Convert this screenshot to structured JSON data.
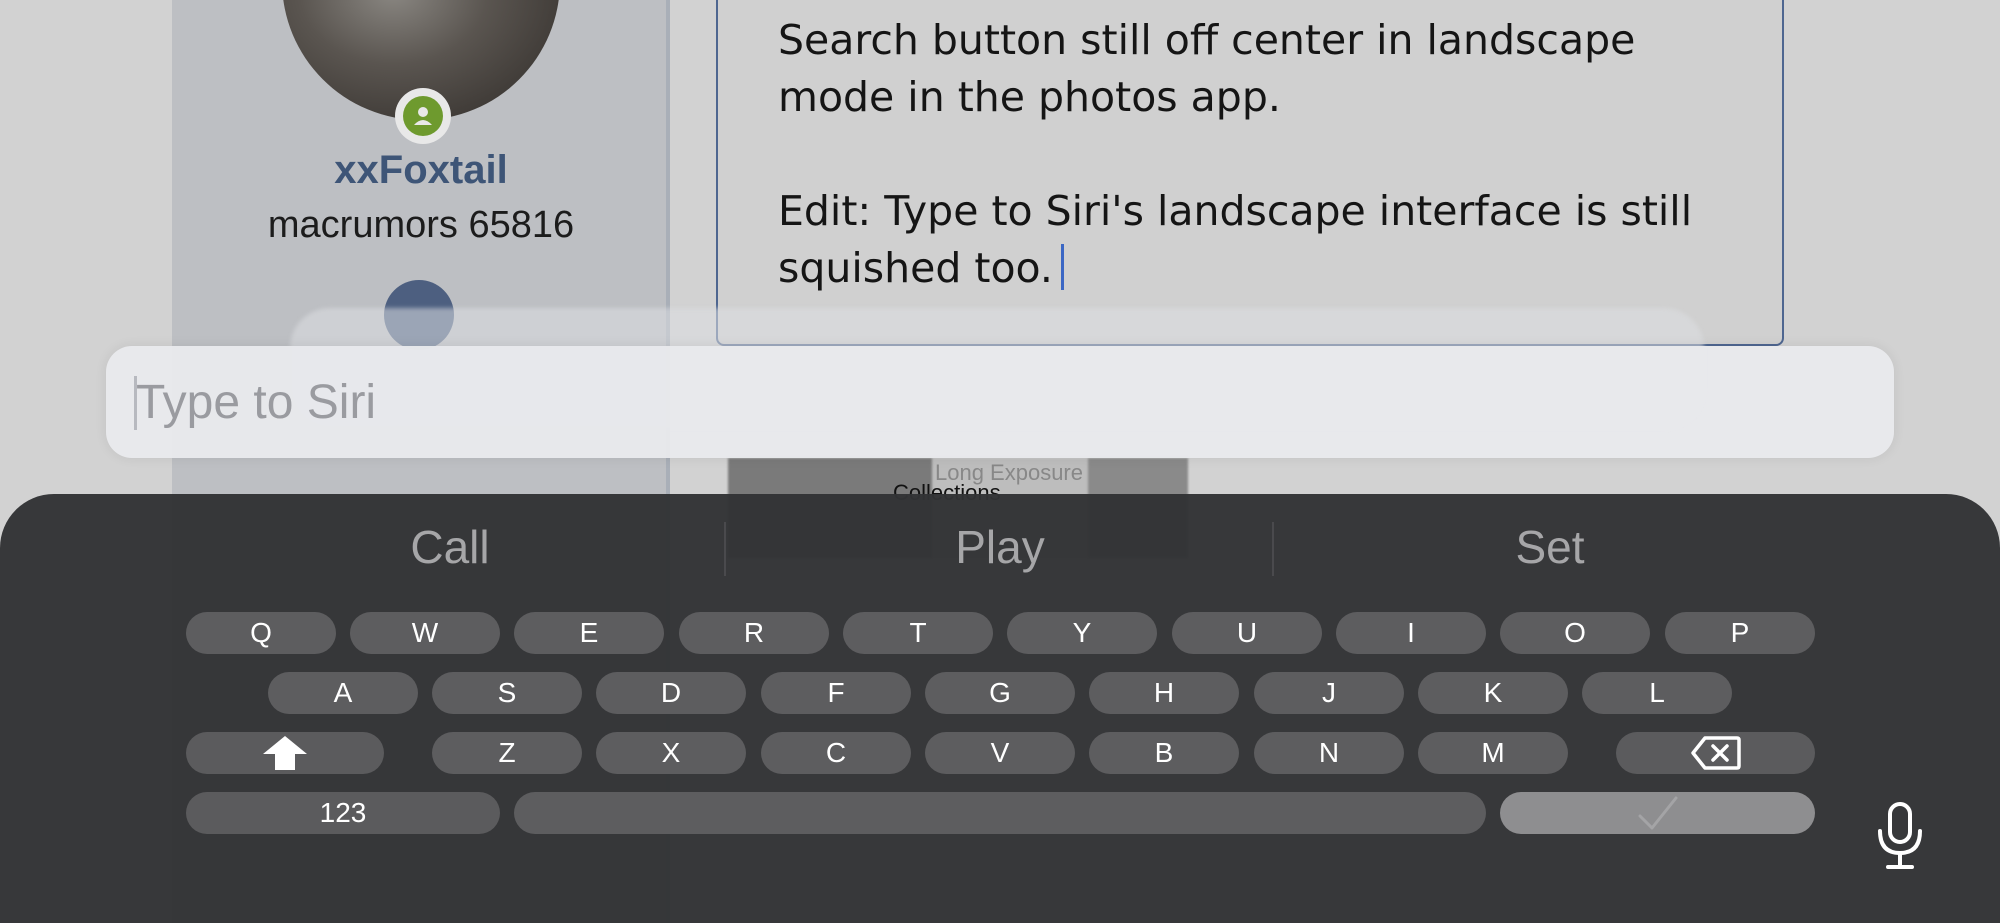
{
  "background": {
    "profile": {
      "username": "xxFoxtail",
      "rank": "macrumors 65816"
    },
    "editor": {
      "paragraph1": "Search button still off center in landscape mode in the photos app.",
      "paragraph2": "Edit: Type to Siri's landscape interface is still squished too."
    },
    "photos_labels": {
      "collections": "Collections",
      "long_exposure": "Long Exposure"
    }
  },
  "siri": {
    "placeholder": "Type to Siri",
    "value": ""
  },
  "keyboard": {
    "suggestions": [
      "Call",
      "Play",
      "Set"
    ],
    "row1": [
      "Q",
      "W",
      "E",
      "R",
      "T",
      "Y",
      "U",
      "I",
      "O",
      "P"
    ],
    "row2": [
      "A",
      "S",
      "D",
      "F",
      "G",
      "H",
      "J",
      "K",
      "L"
    ],
    "row3": [
      "Z",
      "X",
      "C",
      "V",
      "B",
      "N",
      "M"
    ],
    "numbers_label": "123",
    "shift_icon": "shift-up-arrow-icon",
    "delete_icon": "backspace-icon",
    "return_icon": "checkmark-icon",
    "mic_icon": "microphone-icon"
  },
  "colors": {
    "keyboard_bg": "#323335",
    "key_bg": "#5d5d5f",
    "username_color": "#3e5577",
    "cursor_color": "#3b67c4"
  }
}
